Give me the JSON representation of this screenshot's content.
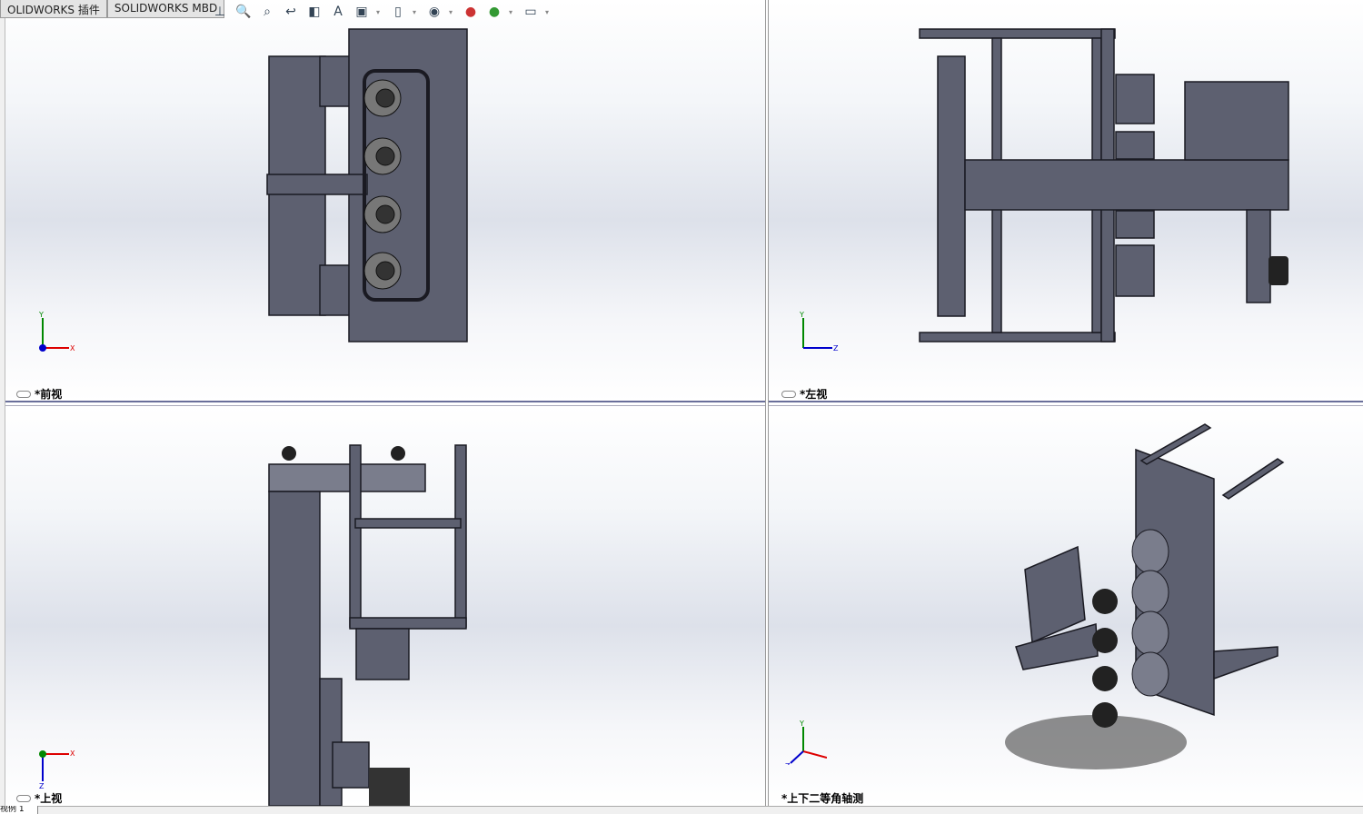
{
  "tabs": [
    {
      "label": "OLIDWORKS 插件"
    },
    {
      "label": "SOLIDWORKS MBD"
    }
  ],
  "toolbar": [
    "view-orientation",
    "zoom-to-fit",
    "zoom-to-area",
    "previous-view",
    "section-view",
    "dynamic-annotation",
    "view-orientation-cube",
    "display-style",
    "hide-show-items",
    "edit-appearance",
    "apply-scene",
    "view-setting"
  ],
  "viewports": [
    {
      "name": "front",
      "label": "*前视",
      "triad": {
        "up": "Y",
        "right": "X"
      }
    },
    {
      "name": "left",
      "label": "*左视",
      "triad": {
        "up": "Y",
        "right": "Z"
      }
    },
    {
      "name": "top",
      "label": "*上视",
      "triad": {
        "up": "X",
        "right": "X",
        "down": "Z"
      }
    },
    {
      "name": "dimetric",
      "label": "*上下二等角轴测",
      "triad": {
        "up": "Y",
        "right": "X",
        "down": "Z"
      }
    }
  ],
  "bottom_tab": "视例 1",
  "colors": {
    "part": "#5d6070",
    "edge": "#1a1a22",
    "x_axis": "#d00",
    "y_axis": "#080",
    "z_axis": "#00c",
    "separator": "#6a6f9a"
  }
}
